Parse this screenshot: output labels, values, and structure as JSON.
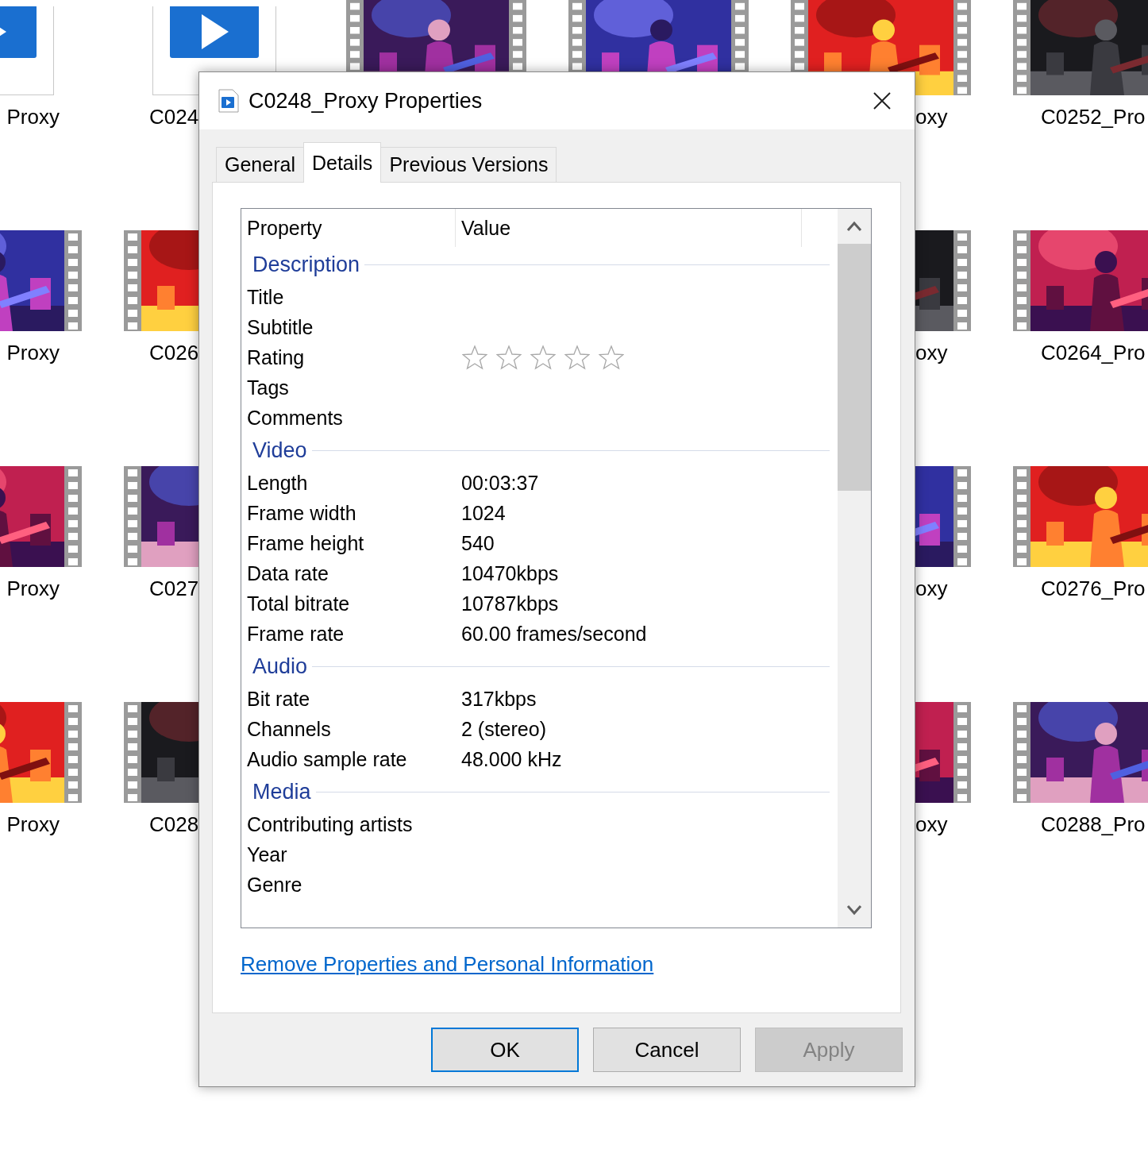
{
  "explorer": {
    "rows": [
      {
        "items": [
          {
            "kind": "file",
            "label": "Proxy"
          },
          {
            "kind": "file",
            "label": "C024"
          },
          {
            "kind": "video"
          },
          {
            "kind": "video"
          },
          {
            "kind": "video",
            "label": "oxy"
          },
          {
            "kind": "video",
            "label": "C0252_Pro"
          }
        ]
      },
      {
        "items": [
          {
            "kind": "video",
            "label": "Proxy"
          },
          {
            "kind": "video",
            "label": "C026"
          },
          {
            "kind": "video",
            "label": "oxy"
          },
          {
            "kind": "video",
            "label": "C0264_Pro"
          }
        ]
      },
      {
        "items": [
          {
            "kind": "video",
            "label": "Proxy"
          },
          {
            "kind": "video",
            "label": "C027"
          },
          {
            "kind": "video",
            "label": "oxy"
          },
          {
            "kind": "video",
            "label": "C0276_Pro"
          }
        ]
      },
      {
        "items": [
          {
            "kind": "video",
            "label": "Proxy"
          },
          {
            "kind": "video",
            "label": "C028"
          },
          {
            "kind": "video",
            "label": "oxy"
          },
          {
            "kind": "video",
            "label": "C0288_Pro"
          }
        ]
      }
    ]
  },
  "dialog": {
    "title": "C0248_Proxy Properties",
    "tabs": [
      {
        "label": "General",
        "selected": false
      },
      {
        "label": "Details",
        "selected": true
      },
      {
        "label": "Previous Versions",
        "selected": false
      }
    ],
    "columns": [
      "Property",
      "Value"
    ],
    "sections": [
      {
        "heading": "Description",
        "rows": [
          {
            "property": "Title"
          },
          {
            "property": "Subtitle"
          },
          {
            "property": "Rating",
            "kind": "stars",
            "stars": 0
          },
          {
            "property": "Tags"
          },
          {
            "property": "Comments"
          }
        ]
      },
      {
        "heading": "Video",
        "rows": [
          {
            "property": "Length",
            "value": "00:03:37"
          },
          {
            "property": "Frame width",
            "value": "1024"
          },
          {
            "property": "Frame height",
            "value": "540"
          },
          {
            "property": "Data rate",
            "value": "10470kbps"
          },
          {
            "property": "Total bitrate",
            "value": "10787kbps"
          },
          {
            "property": "Frame rate",
            "value": "60.00 frames/second"
          }
        ]
      },
      {
        "heading": "Audio",
        "rows": [
          {
            "property": "Bit rate",
            "value": "317kbps"
          },
          {
            "property": "Channels",
            "value": "2 (stereo)"
          },
          {
            "property": "Audio sample rate",
            "value": "48.000 kHz"
          }
        ]
      },
      {
        "heading": "Media",
        "rows": [
          {
            "property": "Contributing artists"
          },
          {
            "property": "Year"
          },
          {
            "property": "Genre"
          }
        ]
      }
    ],
    "link": "Remove Properties and Personal Information",
    "buttons": [
      {
        "label": "OK",
        "default": true,
        "disabled": false
      },
      {
        "label": "Cancel",
        "default": false,
        "disabled": false
      },
      {
        "label": "Apply",
        "default": false,
        "disabled": true
      }
    ]
  }
}
